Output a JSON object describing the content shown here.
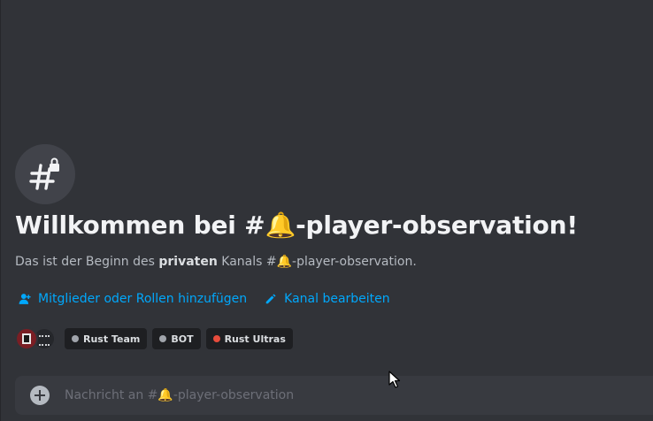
{
  "welcome": {
    "title": "Willkommen bei #🔔-player-observation!",
    "sub_prefix": "Das ist der Beginn des ",
    "sub_bold": "privaten",
    "sub_suffix": " Kanals #🔔-player-observation."
  },
  "actions": {
    "add_members": "Mitglieder oder Rollen hinzufügen",
    "edit_channel": "Kanal bearbeiten"
  },
  "roles": [
    {
      "name": "Rust Team",
      "color": "#a0a4ab"
    },
    {
      "name": "BOT",
      "color": "#a0a4ab"
    },
    {
      "name": "Rust Ultras",
      "color": "#e74c3c"
    }
  ],
  "composer": {
    "placeholder": "Nachricht an #🔔-player-observation"
  },
  "icons": {
    "channel": "private-channel-hash-lock-icon",
    "add_member": "person-add-icon",
    "edit": "pencil-icon",
    "plus": "plus-circle-icon",
    "cursor": "mouse-cursor-icon"
  },
  "colors": {
    "background": "#313338",
    "link": "#00a8fc",
    "title": "#f2f3f5",
    "composer": "#383a40"
  }
}
